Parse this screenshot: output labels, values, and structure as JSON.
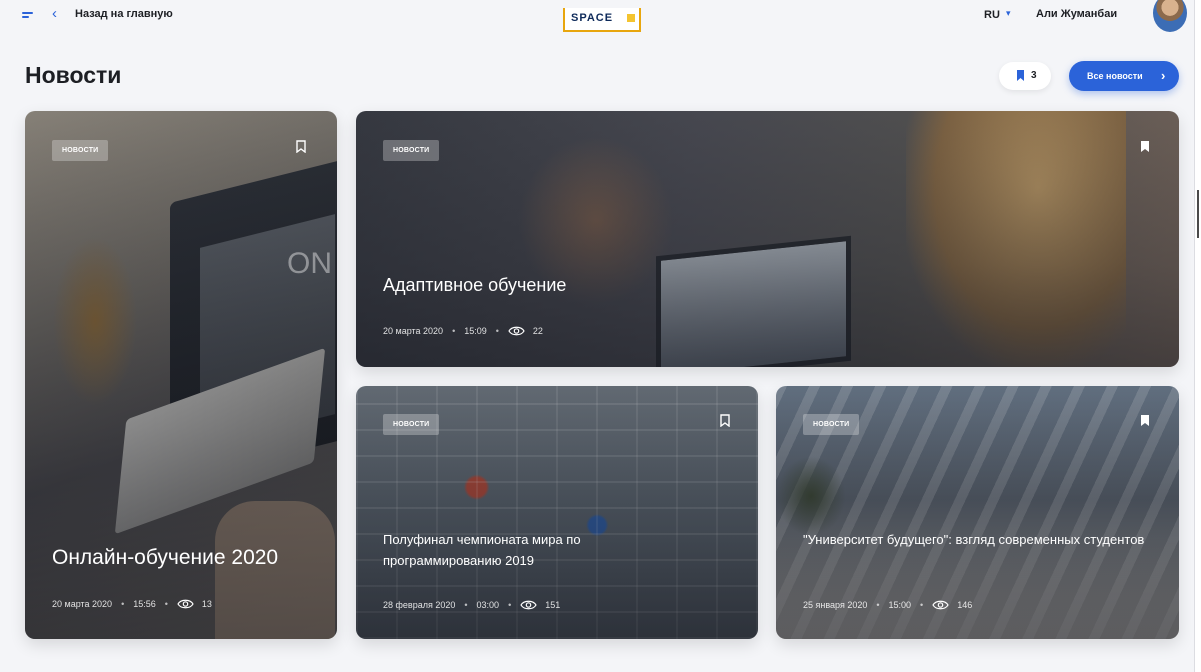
{
  "header": {
    "back_label": "Назад на главную",
    "logo_text": "SPACE",
    "language": "RU",
    "user_name": "Али Жуманбаи"
  },
  "page": {
    "title": "Новости",
    "bookmarks_count": "3",
    "all_news_label": "Все новости"
  },
  "cards": [
    {
      "tag": "НОВОСТИ",
      "title": "Онлайн-обучение 2020",
      "date": "20 марта 2020",
      "time": "15:56",
      "views": "13",
      "bookmarked": false,
      "image_text": "ON"
    },
    {
      "tag": "НОВОСТИ",
      "title": "Адаптивное обучение",
      "date": "20 марта 2020",
      "time": "15:09",
      "views": "22",
      "bookmarked": true
    },
    {
      "tag": "НОВОСТИ",
      "title": "Полуфинал чемпионата мира по программированию 2019",
      "date": "28 февраля 2020",
      "time": "03:00",
      "views": "151",
      "bookmarked": false
    },
    {
      "tag": "НОВОСТИ",
      "title": "\"Университет будущего\": взгляд современных студентов",
      "date": "25 января 2020",
      "time": "15:00",
      "views": "146",
      "bookmarked": true
    }
  ],
  "colors": {
    "accent": "#2b63d9",
    "logo_border": "#e8a60e",
    "background": "#f4f5f8"
  }
}
